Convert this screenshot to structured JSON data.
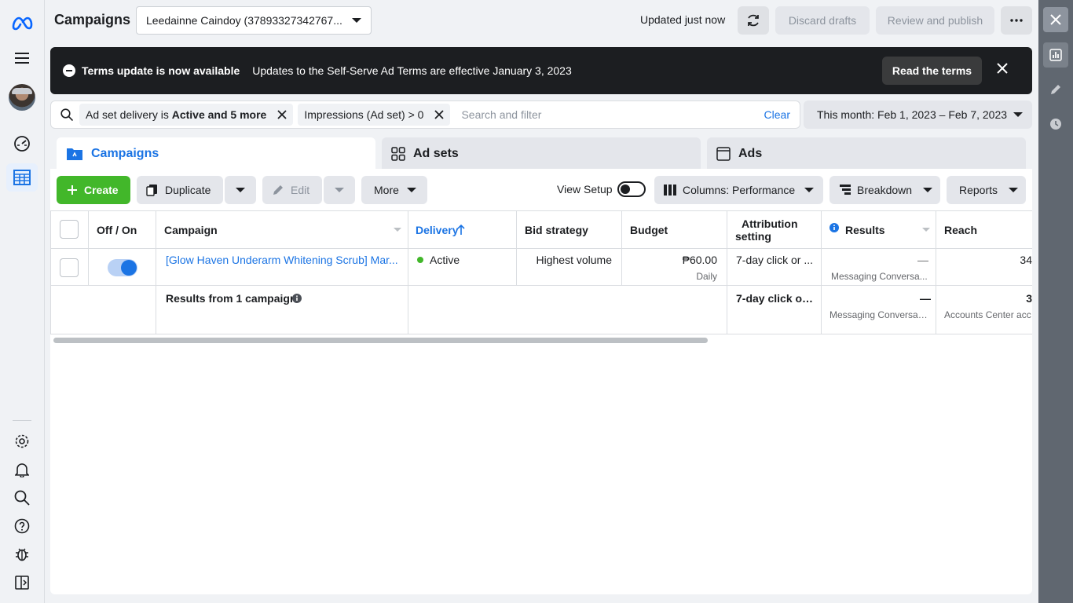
{
  "header": {
    "title": "Campaigns",
    "account": "Leedainne Caindoy (37893327342767...",
    "updated": "Updated just now",
    "discard": "Discard drafts",
    "review": "Review and publish"
  },
  "banner": {
    "title": "Terms update is now available",
    "desc": "Updates to the Self-Serve Ad Terms are effective January 3, 2023",
    "read": "Read the terms"
  },
  "filter": {
    "chip1_pre": "Ad set delivery is",
    "chip1_bold": "Active and 5 more",
    "chip2": "Impressions (Ad set) > 0",
    "placeholder": "Search and filter",
    "clear": "Clear",
    "date": "This month: Feb 1, 2023 – Feb 7, 2023"
  },
  "tabs": {
    "campaigns": "Campaigns",
    "adsets": "Ad sets",
    "ads": "Ads"
  },
  "toolbar": {
    "create": "Create",
    "duplicate": "Duplicate",
    "edit": "Edit",
    "more": "More",
    "view_setup": "View Setup",
    "columns": "Columns: Performance",
    "breakdown": "Breakdown",
    "reports": "Reports"
  },
  "table": {
    "headers": {
      "offon": "Off / On",
      "campaign": "Campaign",
      "delivery": "Delivery",
      "bid": "Bid strategy",
      "budget": "Budget",
      "attribution": "Attribution",
      "attribution2": "setting",
      "results": "Results",
      "reach": "Reach"
    },
    "row": {
      "campaign": "[Glow Haven Underarm Whitening Scrub] Mar...",
      "delivery": "Active",
      "bid": "Highest volume",
      "budget": "₱60.00",
      "budget_sub": "Daily",
      "attribution": "7-day click or ...",
      "results": "—",
      "results_sub": "Messaging Conversa...",
      "reach": "34"
    },
    "summary": {
      "label": "Results from 1 campaign",
      "attribution": "7-day click or ...",
      "results": "—",
      "results_sub": "Messaging Conversati...",
      "reach": "3",
      "reach_sub": "Accounts Center acc"
    }
  },
  "colors": {
    "accent": "#1b74e4",
    "create": "#42b72a",
    "banner": "#1c1e21"
  }
}
